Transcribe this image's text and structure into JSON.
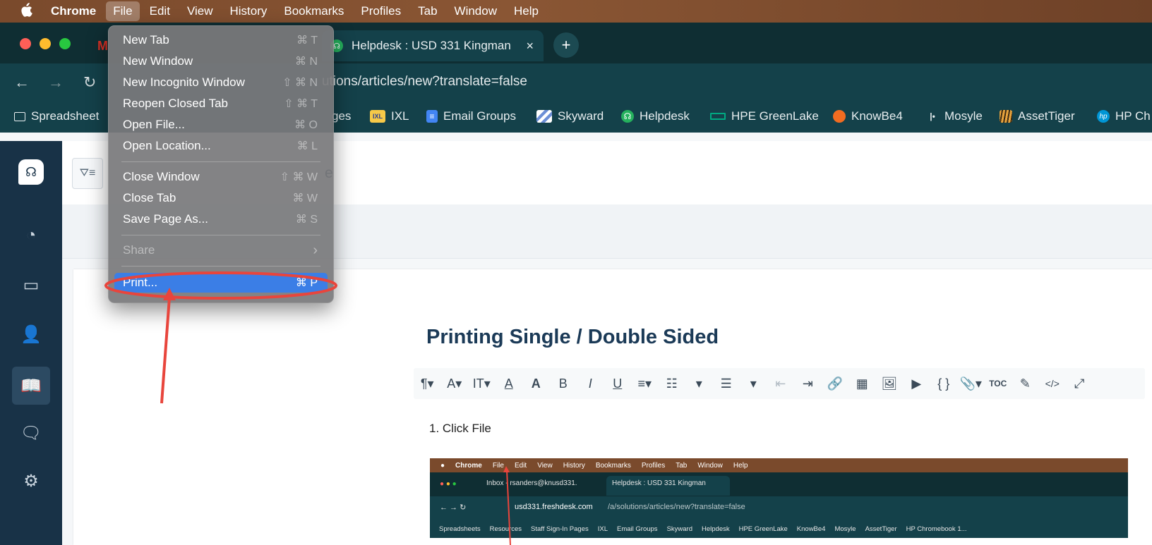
{
  "menubar": {
    "apple": "",
    "items": [
      "Chrome",
      "File",
      "Edit",
      "View",
      "History",
      "Bookmarks",
      "Profiles",
      "Tab",
      "Window",
      "Help"
    ]
  },
  "browser": {
    "active_tab_title": "Helpdesk : USD 331 Kingman",
    "tab_close": "×",
    "new_tab": "+",
    "url_fragment": "utions/articles/new?translate=false"
  },
  "bookmarks": {
    "items": [
      {
        "label": "Spreadsheet"
      },
      {
        "label": "ges"
      },
      {
        "label": "IXL"
      },
      {
        "label": "Email Groups"
      },
      {
        "label": "Skyward"
      },
      {
        "label": "Helpdesk"
      },
      {
        "label": "HPE GreenLake"
      },
      {
        "label": "KnowBe4"
      },
      {
        "label": "Mosyle"
      },
      {
        "label": "AssetTiger"
      },
      {
        "label": "HP Ch"
      }
    ]
  },
  "file_menu": {
    "items": [
      {
        "label": "New Tab",
        "shortcut": "⌘ T"
      },
      {
        "label": "New Window",
        "shortcut": "⌘ N"
      },
      {
        "label": "New Incognito Window",
        "shortcut": "⇧ ⌘ N"
      },
      {
        "label": "Reopen Closed Tab",
        "shortcut": "⇧ ⌘ T"
      },
      {
        "label": "Open File...",
        "shortcut": "⌘ O"
      },
      {
        "label": "Open Location...",
        "shortcut": "⌘ L"
      },
      {
        "label": "Close Window",
        "shortcut": "⇧ ⌘ W"
      },
      {
        "label": "Close Tab",
        "shortcut": "⌘ W"
      },
      {
        "label": "Save Page As...",
        "shortcut": "⌘ S"
      },
      {
        "label": "Share",
        "shortcut": "›"
      },
      {
        "label": "Print...",
        "shortcut": "⌘ P"
      }
    ]
  },
  "app": {
    "header_fragment": "e",
    "article_title": "Printing Single / Double Sided",
    "editor_tools": [
      "¶▾",
      "A▾",
      "IT▾",
      "A",
      "A",
      "B",
      "I",
      "U",
      "≡▾",
      "☷",
      "▾",
      "☰",
      "▾",
      "⇤",
      "⇥",
      "🔗",
      "▦",
      "🖼",
      "▶",
      "{ }",
      "📎▾",
      "TOC",
      "✎",
      "</>",
      "⤢"
    ],
    "step1": "1. Click File"
  },
  "embedded_screenshot": {
    "menubar": [
      "Chrome",
      "File",
      "Edit",
      "View",
      "History",
      "Bookmarks",
      "Profiles",
      "Tab",
      "Window",
      "Help"
    ],
    "tab1": "Inbox - rsanders@knusd331.",
    "tab2": "Helpdesk : USD 331 Kingman",
    "url_host": "usd331.freshdesk.com",
    "url_path": "/a/solutions/articles/new?translate=false",
    "bookmarks": [
      "Spreadsheets",
      "Resources",
      "Staff Sign-In Pages",
      "IXL",
      "Email Groups",
      "Skyward",
      "Helpdesk",
      "HPE GreenLake",
      "KnowBe4",
      "Mosyle",
      "AssetTiger",
      "HP Chromebook 1..."
    ]
  },
  "colors": {
    "menubar_brown": "#7a4a2c",
    "chrome_teal": "#14414a",
    "menu_highlight": "#3b7ee6",
    "annotation_red": "#e8453c",
    "rail_navy": "#183247"
  }
}
